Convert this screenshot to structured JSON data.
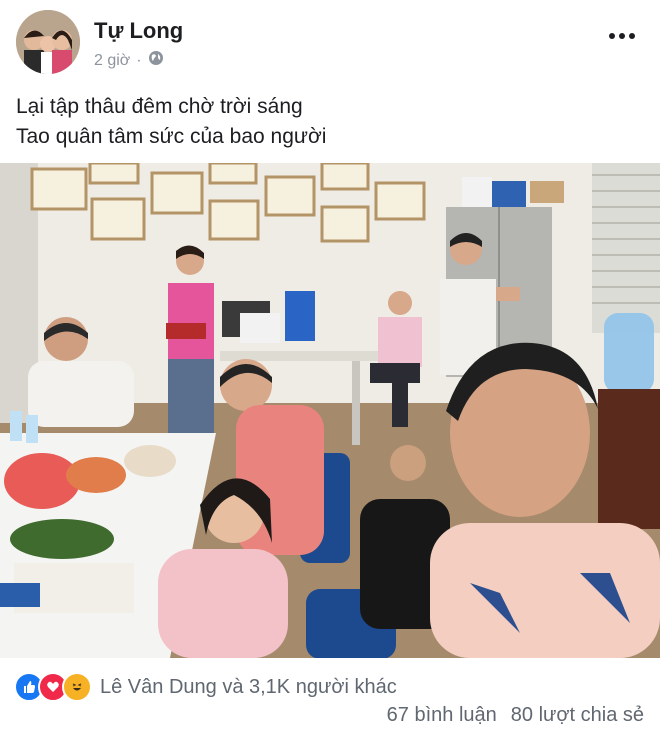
{
  "post": {
    "author": "Tự Long",
    "time": "2 giờ",
    "separator": "·",
    "caption_lines": [
      "Lại tập thâu đêm chờ trời sáng",
      "Tao quân tâm sức của bao người"
    ]
  },
  "reactions": {
    "icons": [
      "like-icon",
      "love-icon",
      "haha-icon"
    ],
    "summary": "Lê Vân Dung và 3,1K người khác",
    "comments": "67 bình luận",
    "shares": "80 lượt chia sẻ"
  },
  "colors": {
    "like": "#1877f2",
    "love": "#f0284a",
    "haha": "#f7b125",
    "muted_text": "#606770"
  }
}
